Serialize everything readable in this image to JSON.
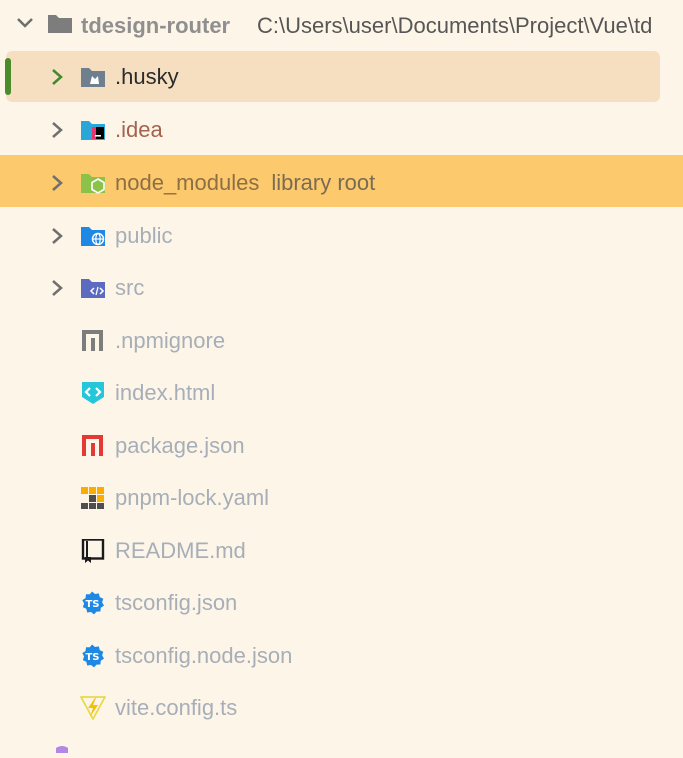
{
  "project": {
    "name": "tdesign-router",
    "path": "C:\\Users\\user\\Documents\\Project\\Vue\\td"
  },
  "tree": [
    {
      "label": ".husky",
      "icon": "husky-folder-icon",
      "color": "#2b2b2b"
    },
    {
      "label": ".idea",
      "icon": "idea-folder-icon",
      "color": "#a4624f"
    },
    {
      "label": "node_modules",
      "hint": "library root",
      "icon": "node-modules-folder-icon",
      "color": "#8d6f45"
    },
    {
      "label": "public",
      "icon": "public-folder-icon",
      "color": "#a7aeb8"
    },
    {
      "label": "src",
      "icon": "src-folder-icon",
      "color": "#a7aeb8"
    },
    {
      "label": ".npmignore",
      "icon": "npmignore-file-icon",
      "color": "#a7aeb8"
    },
    {
      "label": "index.html",
      "icon": "html-file-icon",
      "color": "#a7aeb8"
    },
    {
      "label": "package.json",
      "icon": "npm-package-file-icon",
      "color": "#a7aeb8"
    },
    {
      "label": "pnpm-lock.yaml",
      "icon": "pnpm-lock-file-icon",
      "color": "#a7aeb8"
    },
    {
      "label": "README.md",
      "icon": "readme-file-icon",
      "color": "#a7aeb8"
    },
    {
      "label": "tsconfig.json",
      "icon": "tsconfig-file-icon",
      "color": "#a7aeb8"
    },
    {
      "label": "tsconfig.node.json",
      "icon": "tsconfig-file-icon",
      "color": "#a7aeb8"
    },
    {
      "label": "vite.config.ts",
      "icon": "vite-config-file-icon",
      "color": "#a7aeb8"
    }
  ],
  "colors": {
    "background": "#fdf6e8",
    "selected_row": "#f6dfc0",
    "highlighted_row": "#fdc96d",
    "focus_bar": "#4a8c2a"
  }
}
